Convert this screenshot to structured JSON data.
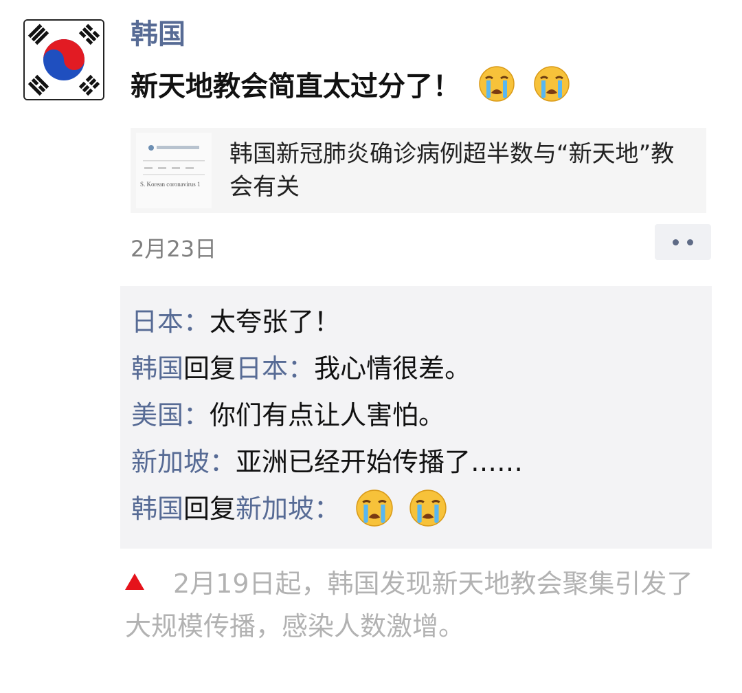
{
  "post": {
    "nickname": "韩国",
    "text": "新天地教会简直太过分了！",
    "text_emojis": [
      "crying-face",
      "crying-face"
    ],
    "link_card": {
      "title": "韩国新冠肺炎确诊病例超半数与“新天地”教会有关",
      "thumb_caption": "S. Korean coronavirus 1"
    },
    "timestamp": "2月23日"
  },
  "comments": [
    {
      "name": "日本",
      "separator": "：",
      "text": "太夸张了！"
    },
    {
      "name": "韩国",
      "reply_word": "回复",
      "reply_to": "日本",
      "separator": "：",
      "text": "我心情很差。"
    },
    {
      "name": "美国",
      "separator": "：",
      "text": "你们有点让人害怕。"
    },
    {
      "name": "新加坡",
      "separator": "：",
      "text": "亚洲已经开始传播了……"
    },
    {
      "name": "韩国",
      "reply_word": "回复",
      "reply_to": "新加坡",
      "separator": "：",
      "emojis": [
        "crying-face",
        "crying-face"
      ]
    }
  ],
  "caption": "2月19日起，韩国发现新天地教会聚集引发了大规模传播，感染人数激增。",
  "colors": {
    "name_blue": "#576b95",
    "caption_gray": "#b2b2b2",
    "triangle_red": "#e5131b",
    "comment_bg": "#f3f3f5"
  }
}
